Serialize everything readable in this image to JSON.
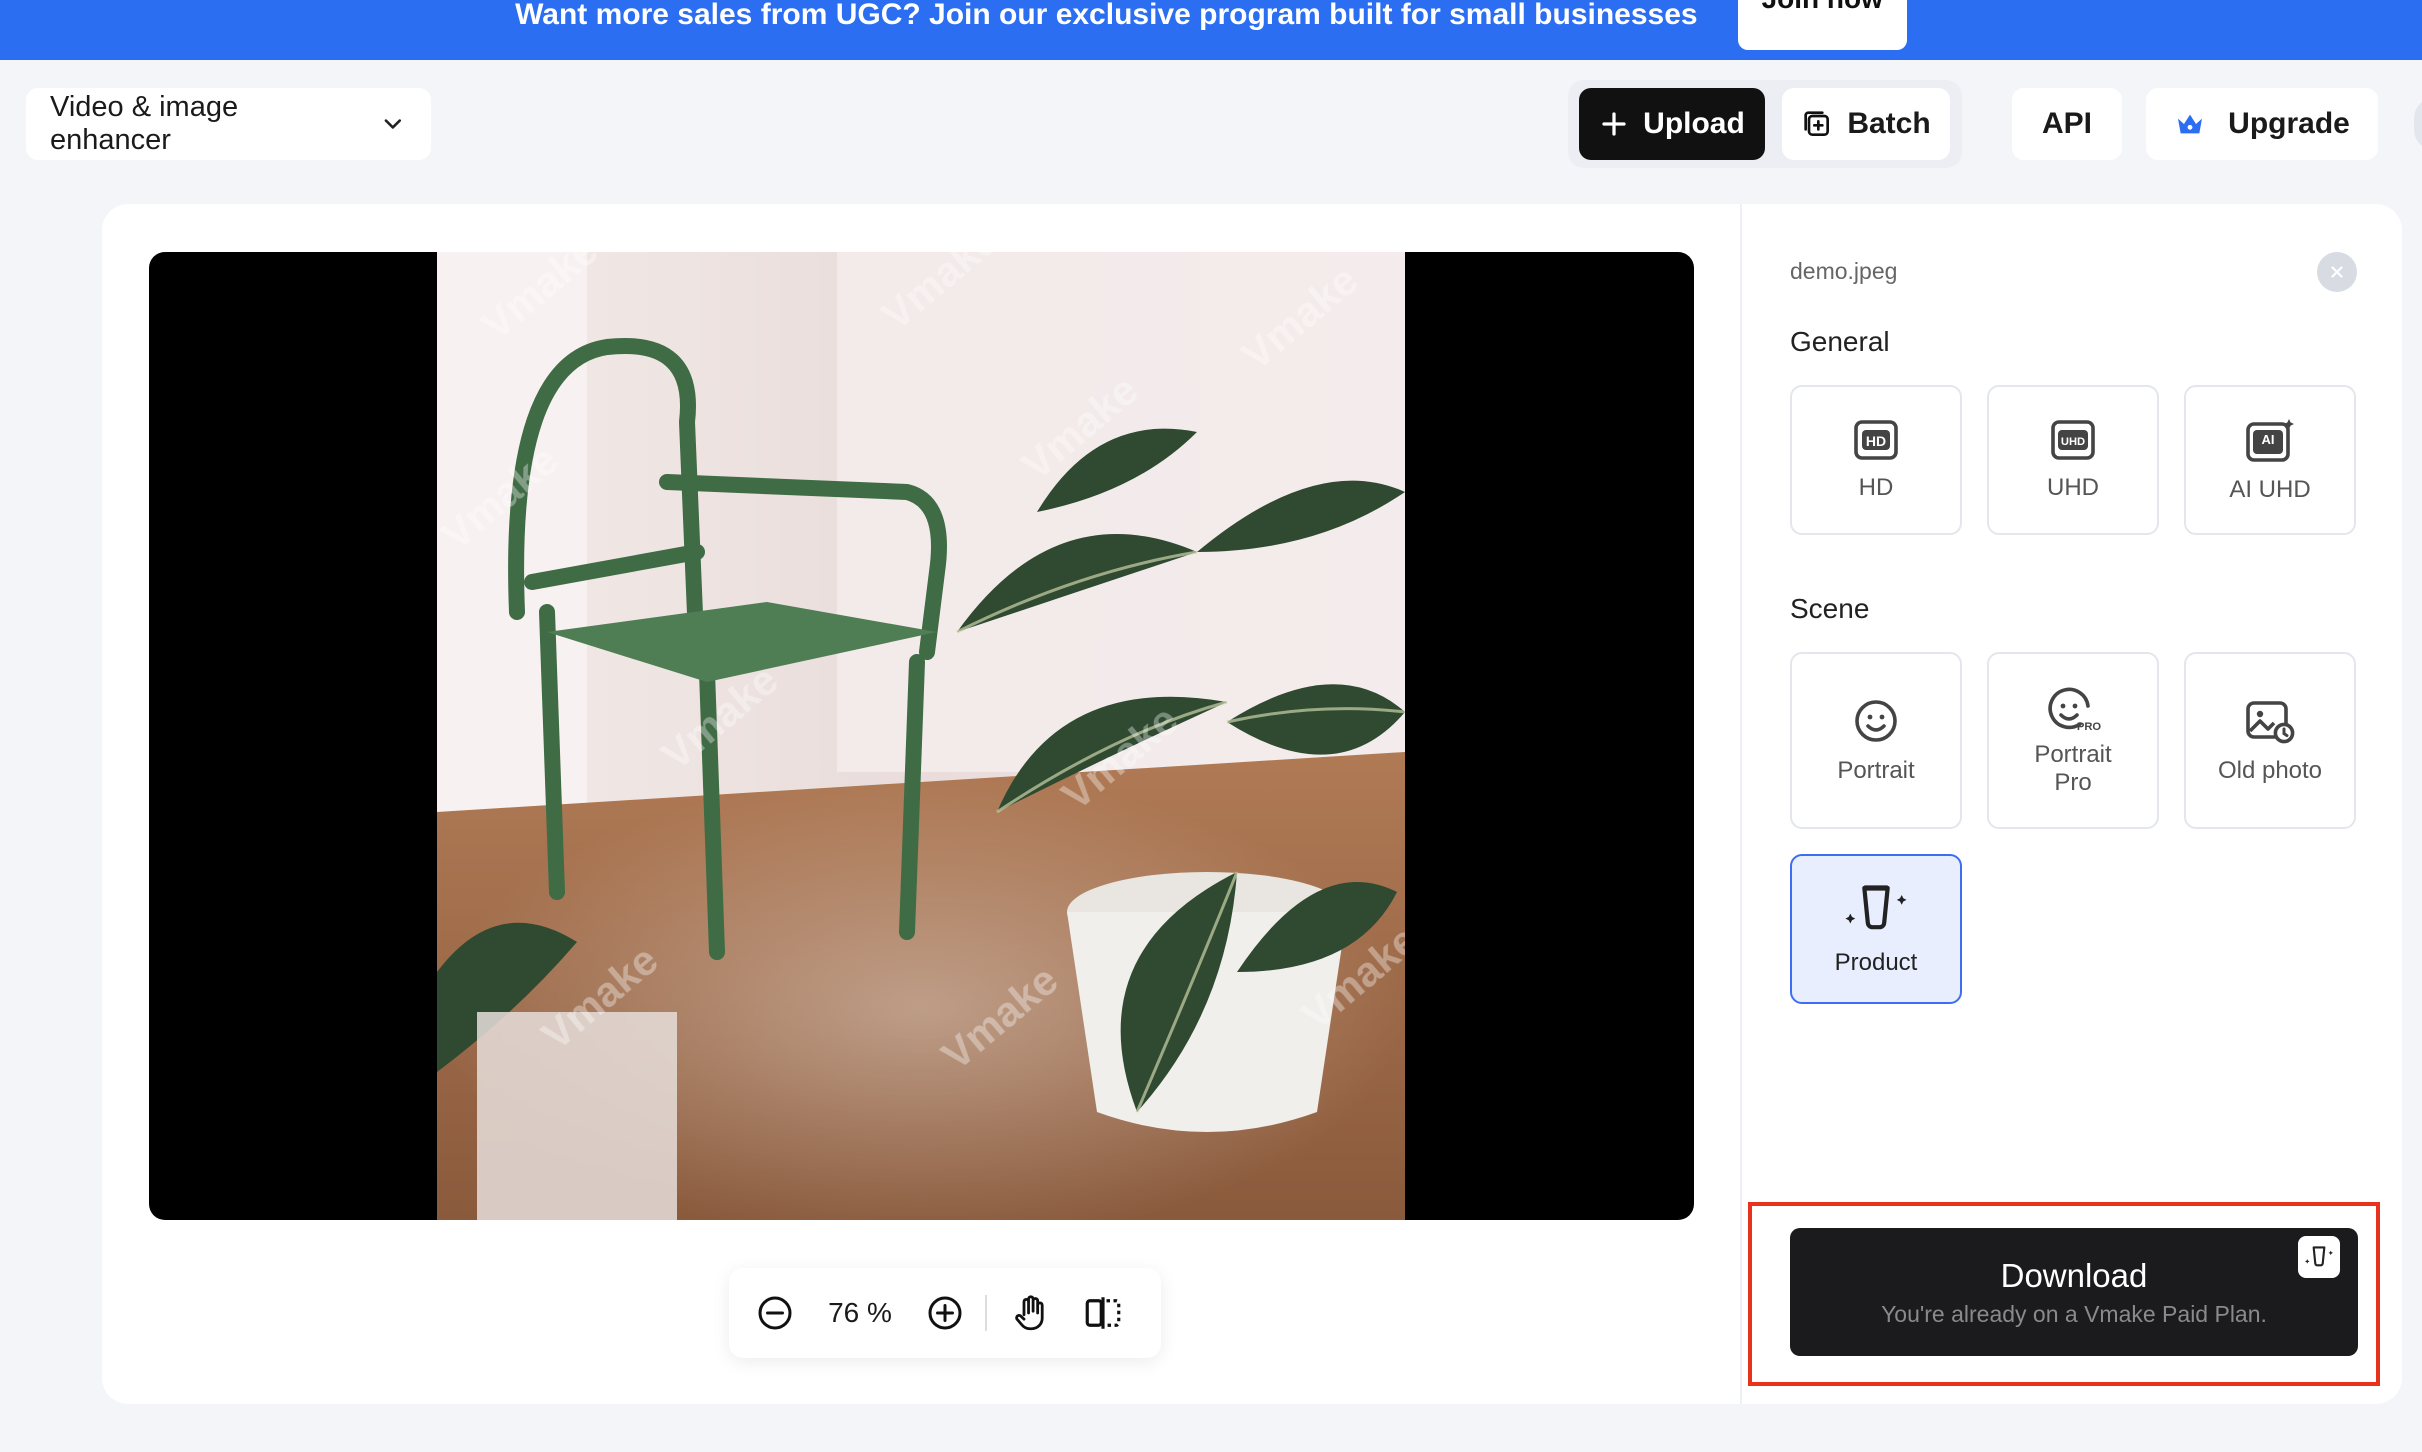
{
  "banner": {
    "text": "Want more sales from UGC? Join our exclusive program built for small businesses",
    "cta_label": "Join now"
  },
  "header": {
    "tool_select_label": "Video & image enhancer",
    "upload_label": "Upload",
    "batch_label": "Batch",
    "api_label": "API",
    "upgrade_label": "Upgrade"
  },
  "viewer": {
    "zoom_value": "76 %",
    "icons": [
      "zoom-out-icon",
      "zoom-in-icon",
      "hand-pan-icon",
      "compare-split-icon"
    ]
  },
  "panel": {
    "file_name": "demo.jpeg",
    "general_title": "General",
    "general_options": [
      {
        "label": "HD",
        "icon": "hd-icon"
      },
      {
        "label": "UHD",
        "icon": "uhd-icon"
      },
      {
        "label": "AI UHD",
        "icon": "ai-uhd-icon"
      }
    ],
    "scene_title": "Scene",
    "scene_options": [
      {
        "label": "Portrait",
        "icon": "portrait-icon"
      },
      {
        "label_line1": "Portrait",
        "label_line2": "Pro",
        "icon": "portrait-pro-icon"
      },
      {
        "label": "Old photo",
        "icon": "old-photo-icon"
      },
      {
        "label": "Product",
        "icon": "product-icon",
        "selected": true
      }
    ],
    "download_label": "Download",
    "download_sub": "You're already on a Vmake Paid Plan."
  },
  "colors": {
    "banner": "#2b6ef2",
    "selected_border": "#3d6df2",
    "selected_fill": "#e9eeff",
    "highlight": "#e8321c",
    "download_bg": "#1b1b1d"
  }
}
